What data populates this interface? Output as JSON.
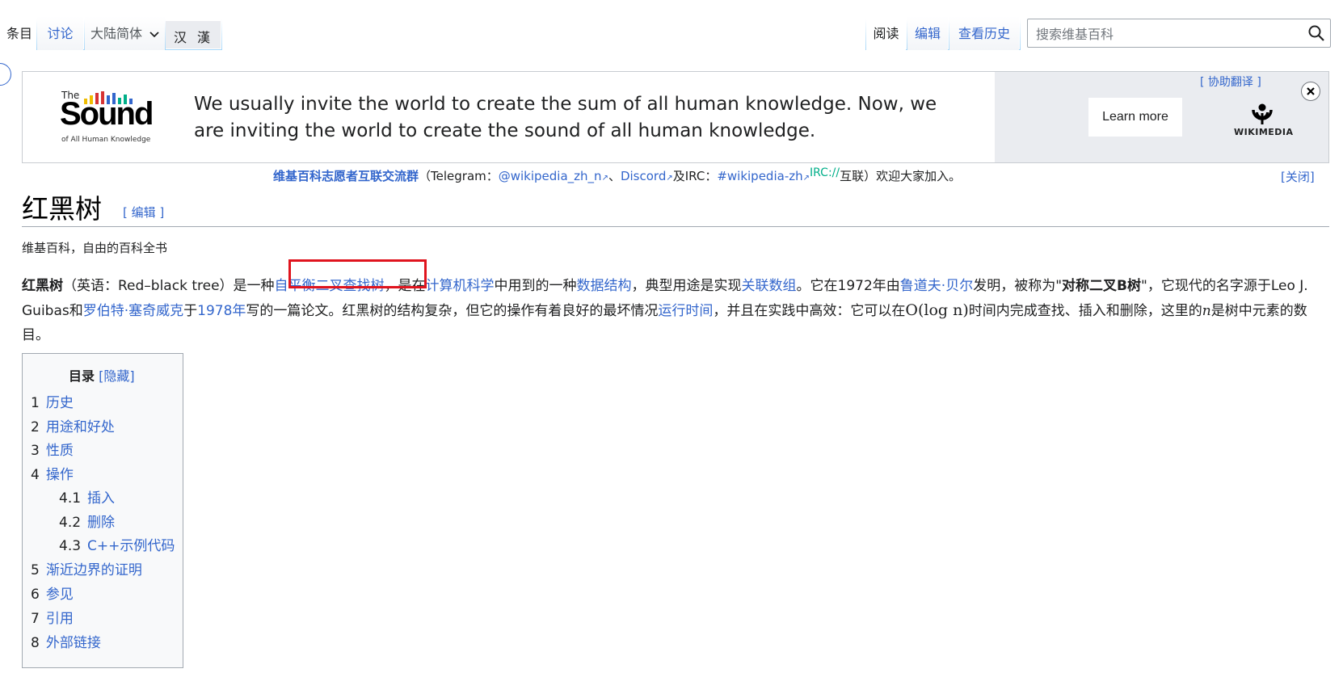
{
  "tabs": {
    "article": "条目",
    "talk": "讨论",
    "variant": "大陆简体",
    "variant_chars": [
      "汉",
      "漢"
    ],
    "read": "阅读",
    "edit": "编辑",
    "history": "查看历史"
  },
  "search": {
    "placeholder": "搜索维基百科",
    "icon": "magnifier-icon"
  },
  "banner": {
    "logo_the": "The",
    "logo_sound": "Sound",
    "logo_sub": "of All Human Knowledge",
    "message": "We usually invite the world to create the sum of all human knowledge. Now, we are inviting the world to create the sound of all human knowledge.",
    "learn_more": "Learn more",
    "translate_link": "[ 协助翻译 ]",
    "wikimedia": "WIKIMEDIA",
    "close_icon": "close-icon"
  },
  "notice": {
    "group_link": "维基百科志愿者互联交流群",
    "paren_open": "（Telegram：",
    "telegram": "@wikipedia_zh_n",
    "sep1": "、",
    "discord": "Discord",
    "and_irc": "及IRC：",
    "irc_channel": "#wikipedia-zh",
    "irc_tag": "IRC://",
    "tail": "互联）欢迎大家加入。",
    "close": "[关闭]"
  },
  "article": {
    "title": "红黑树",
    "edit_link": "[ 编辑 ]",
    "tagline": "维基百科，自由的百科全书",
    "p": {
      "term": "红黑树",
      "t1": "（英语：Red–black tree）是一种",
      "l1": "自平衡二叉查找树",
      "t2": "，是在",
      "l2": "计算机科学",
      "t3": "中用到的一种",
      "l3": "数据结构",
      "t4": "，典型用途是实现",
      "l4": "关联数组",
      "t5": "。它在1972年由",
      "l5": "鲁道夫·贝尔",
      "t6": "发明，被称为\"",
      "b1": "对称二叉B树",
      "t7": "\"，它现代的名字源于Leo J. Guibas和",
      "l6": "罗伯特·塞奇威克",
      "t8": "于",
      "l7": "1978年",
      "t9": "写的一篇论文。红黑树的结构复杂，但它的操作有着良好的最坏情况",
      "l8": "运行时间",
      "t10": "，并且在实践中高效：它可以在",
      "math": "O(log n)",
      "t11": "时间内完成查找、插入和删除，这里的",
      "var_n": "n",
      "t12": "是树中元素的数目。"
    }
  },
  "toc": {
    "title": "目录",
    "toggle": "[隐藏]",
    "items": [
      {
        "num": "1",
        "label": "历史"
      },
      {
        "num": "2",
        "label": "用途和好处"
      },
      {
        "num": "3",
        "label": "性质"
      },
      {
        "num": "4",
        "label": "操作"
      },
      {
        "num": "4.1",
        "label": "插入"
      },
      {
        "num": "4.2",
        "label": "删除"
      },
      {
        "num": "4.3",
        "label": "C++示例代码"
      },
      {
        "num": "5",
        "label": "渐近边界的证明"
      },
      {
        "num": "6",
        "label": "参见"
      },
      {
        "num": "7",
        "label": "引用"
      },
      {
        "num": "8",
        "label": "外部链接"
      }
    ]
  },
  "colors": {
    "link": "#3366cc",
    "highlight": "#e0141e",
    "tab_border": "#a7d7f9"
  }
}
